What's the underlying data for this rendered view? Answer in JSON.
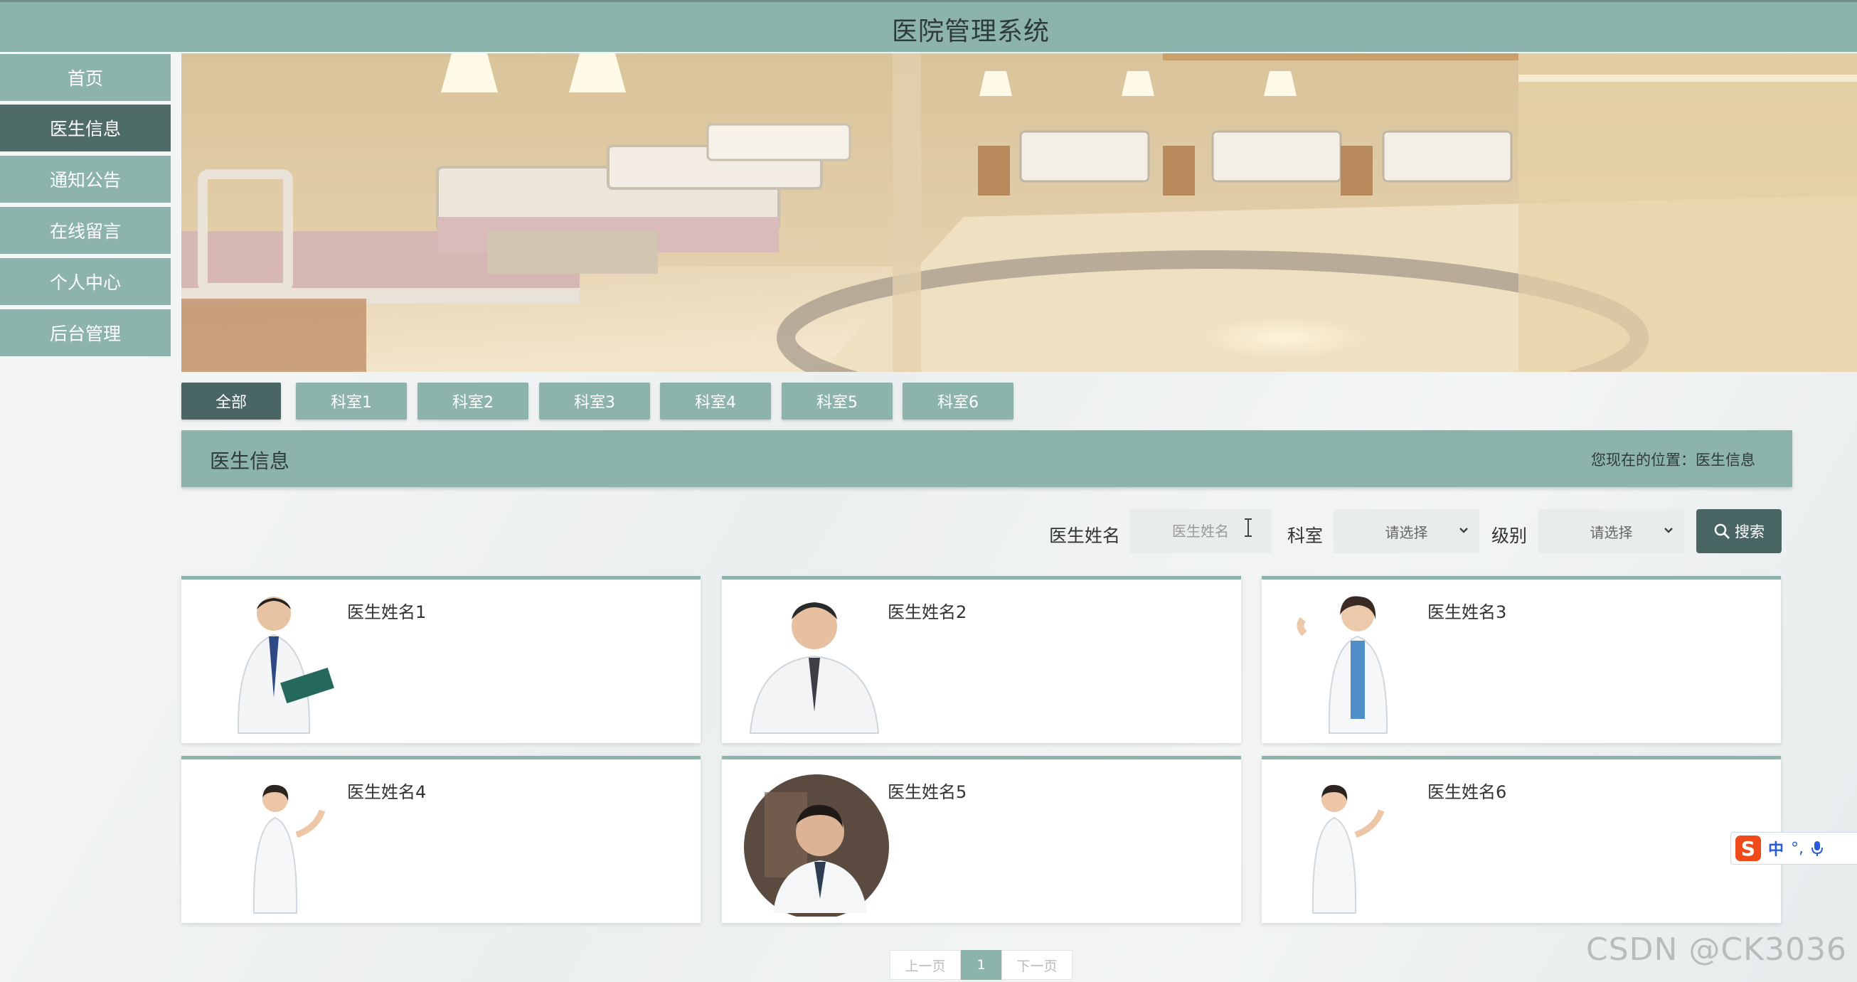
{
  "header": {
    "title": "医院管理系统"
  },
  "sidebar": {
    "items": [
      {
        "label": "首页"
      },
      {
        "label": "医生信息"
      },
      {
        "label": "通知公告"
      },
      {
        "label": "在线留言"
      },
      {
        "label": "个人中心"
      },
      {
        "label": "后台管理"
      }
    ],
    "active_index": 1
  },
  "tabs": [
    {
      "label": "全部"
    },
    {
      "label": "科室1"
    },
    {
      "label": "科室2"
    },
    {
      "label": "科室3"
    },
    {
      "label": "科室4"
    },
    {
      "label": "科室5"
    },
    {
      "label": "科室6"
    }
  ],
  "section": {
    "title": "医生信息",
    "breadcrumb": "您现在的位置：医生信息"
  },
  "search": {
    "name_label": "医生姓名",
    "name_placeholder": "医生姓名",
    "dept_label": "科室",
    "dept_value": "请选择",
    "level_label": "级别",
    "level_value": "请选择",
    "button_label": "搜索"
  },
  "doctors": [
    {
      "name": "医生姓名1"
    },
    {
      "name": "医生姓名2"
    },
    {
      "name": "医生姓名3"
    },
    {
      "name": "医生姓名4"
    },
    {
      "name": "医生姓名5"
    },
    {
      "name": "医生姓名6"
    }
  ],
  "pagination": {
    "prev": "上一页",
    "current": "1",
    "next": "下一页"
  },
  "ime": {
    "logo": "S",
    "lang": "中",
    "punct": "°,"
  },
  "watermark": "CSDN @CK3036",
  "colors": {
    "primary": "#8db3ad",
    "primary_dark": "#4a6664",
    "sidebar_active": "#4e6b68"
  }
}
